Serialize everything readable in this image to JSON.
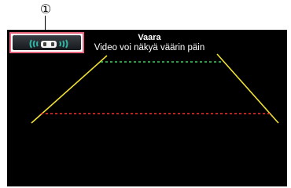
{
  "callout": {
    "marker": "①"
  },
  "warning": {
    "title": "Vaara",
    "message": "Video voi näkyä väärin päin"
  },
  "sensor_button": {
    "icon": "parking-sensor-car-icon"
  },
  "guide_lines": {
    "side_color": "#f0e032",
    "far_color": "#40d060",
    "near_color": "#ff2a2a"
  },
  "colors": {
    "screen_background": "#000000",
    "callout_highlight": "#e8657e",
    "sensor_waves": "#2fb3a3"
  }
}
